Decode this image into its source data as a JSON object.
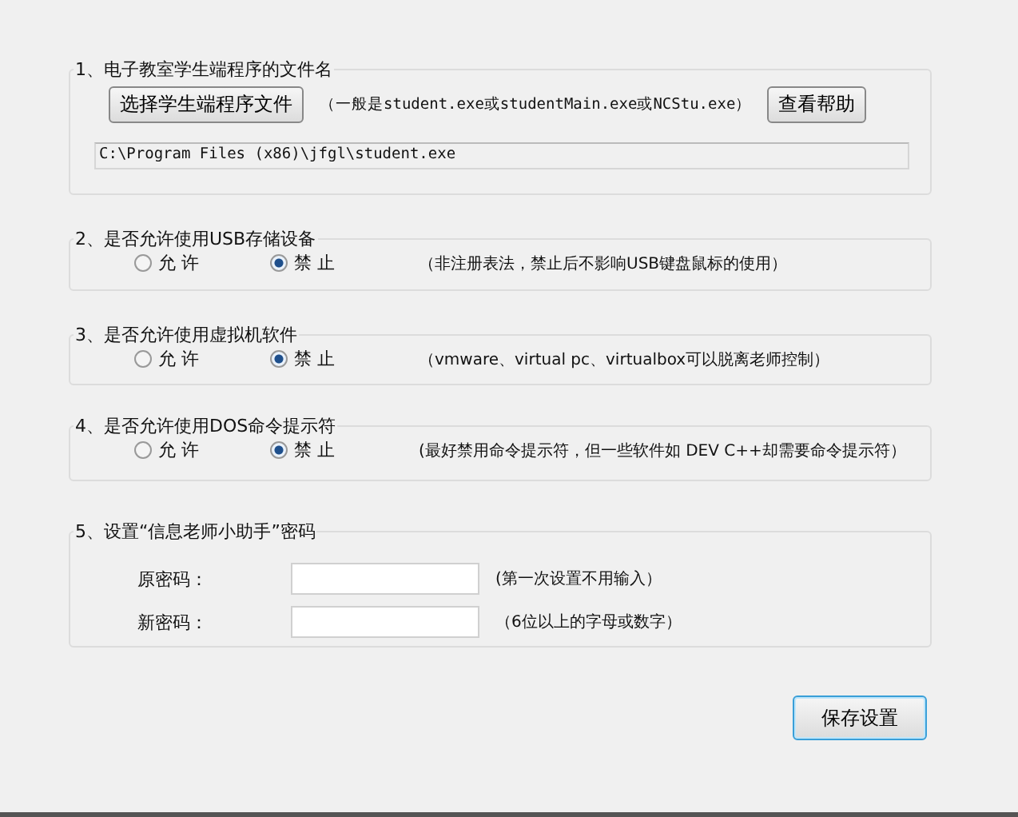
{
  "file_section": {
    "title": "1、电子教室学生端程序的文件名",
    "choose_button": "选择学生端程序文件",
    "hint": "（一般是student.exe或studentMain.exe或NCStu.exe）",
    "help_button": "查看帮助",
    "path": "C:\\Program Files (x86)\\jfgl\\student.exe"
  },
  "options": [
    {
      "title": "2、是否允许使用USB存储设备",
      "choices": [
        {
          "label": "允 许",
          "selected": false
        },
        {
          "label": "禁 止",
          "selected": true
        }
      ],
      "note": "（非注册表法，禁止后不影响USB键盘鼠标的使用）"
    },
    {
      "title": "3、是否允许使用虚拟机软件",
      "choices": [
        {
          "label": "允 许",
          "selected": false
        },
        {
          "label": "禁 止",
          "selected": true
        }
      ],
      "note": "（vmware、virtual pc、virtualbox可以脱离老师控制）"
    },
    {
      "title": "4、是否允许使用DOS命令提示符",
      "choices": [
        {
          "label": "允 许",
          "selected": false
        },
        {
          "label": "禁 止",
          "selected": true
        }
      ],
      "note": "(最好禁用命令提示符，但一些软件如 DEV C++却需要命令提示符）"
    }
  ],
  "password_section": {
    "title": "5、设置“信息老师小助手”密码",
    "fields": [
      {
        "label": "原密码：",
        "hint": "(第一次设置不用输入）"
      },
      {
        "label": "新密码：",
        "hint": "（6位以上的字母或数字）"
      }
    ]
  },
  "save_button": "保存设置"
}
